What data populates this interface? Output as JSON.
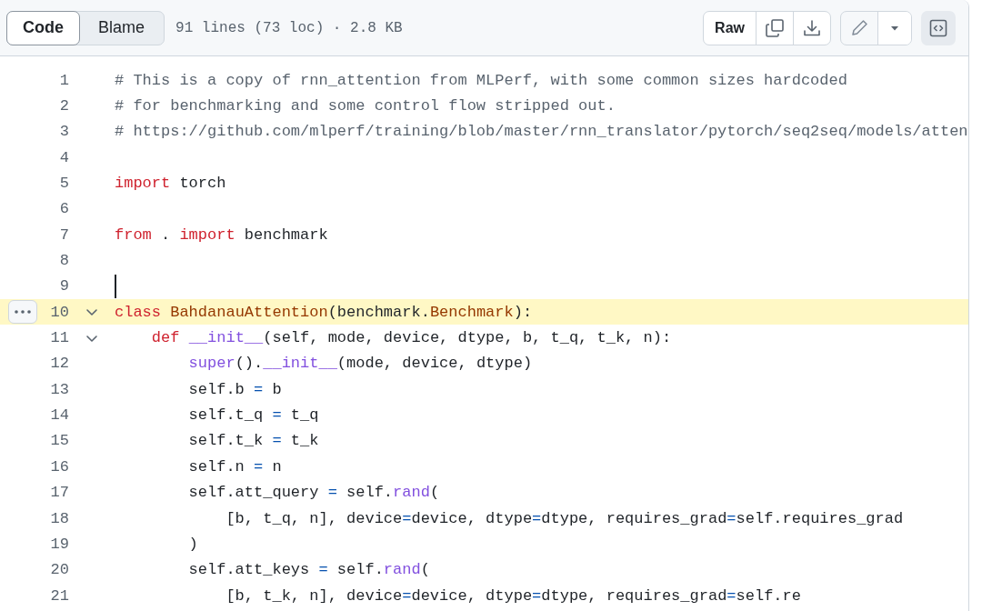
{
  "toolbar": {
    "view_tabs": [
      {
        "label": "Code",
        "selected": true
      },
      {
        "label": "Blame",
        "selected": false
      }
    ],
    "file_info": "91 lines (73 loc) · 2.8 KB",
    "raw_button": "Raw",
    "symbols_button": {
      "selected": true
    }
  },
  "code": {
    "lines": [
      {
        "number": "1",
        "selected": false,
        "cursor": false,
        "foldable": false,
        "tokens": [
          {
            "kind": "comment",
            "text": "# This is a copy of rnn_attention from MLPerf, with some common sizes hardcoded"
          }
        ]
      },
      {
        "number": "2",
        "selected": false,
        "cursor": false,
        "foldable": false,
        "tokens": [
          {
            "kind": "comment",
            "text": "# for benchmarking and some control flow stripped out."
          }
        ]
      },
      {
        "number": "3",
        "selected": false,
        "cursor": false,
        "foldable": false,
        "tokens": [
          {
            "kind": "comment",
            "text": "# https://github.com/mlperf/training/blob/master/rnn_translator/pytorch/seq2seq/models/atten"
          }
        ]
      },
      {
        "number": "4",
        "selected": false,
        "cursor": false,
        "foldable": false
      },
      {
        "number": "5",
        "selected": false,
        "cursor": false,
        "foldable": false,
        "tokens": [
          {
            "kind": "keyword",
            "text": "import"
          },
          {
            "kind": "plain",
            "text": " torch"
          }
        ]
      },
      {
        "number": "6",
        "selected": false,
        "cursor": false,
        "foldable": false
      },
      {
        "number": "7",
        "selected": false,
        "cursor": false,
        "foldable": false,
        "tokens": [
          {
            "kind": "keyword",
            "text": "from"
          },
          {
            "kind": "plain",
            "text": " . "
          },
          {
            "kind": "keyword",
            "text": "import"
          },
          {
            "kind": "plain",
            "text": " benchmark"
          }
        ]
      },
      {
        "number": "8",
        "selected": false,
        "cursor": false,
        "foldable": false
      },
      {
        "number": "9",
        "selected": false,
        "cursor": true,
        "foldable": false
      },
      {
        "number": "10",
        "selected": true,
        "cursor": false,
        "foldable": true,
        "tokens": [
          {
            "kind": "keyword",
            "text": "class "
          },
          {
            "kind": "name",
            "text": "BahdanauAttention"
          },
          {
            "kind": "plain",
            "text": "(benchmark."
          },
          {
            "kind": "name",
            "text": "Benchmark"
          },
          {
            "kind": "plain",
            "text": "):"
          }
        ]
      },
      {
        "number": "11",
        "selected": false,
        "cursor": false,
        "foldable": true,
        "tokens": [
          {
            "kind": "keyword",
            "text": "    def "
          },
          {
            "kind": "call",
            "text": "__init__"
          },
          {
            "kind": "plain",
            "text": "(self, mode, device, dtype, b, t_q, t_k, n):"
          }
        ]
      },
      {
        "number": "12",
        "selected": false,
        "cursor": false,
        "foldable": false,
        "tokens": [
          {
            "kind": "call",
            "text": "        super"
          },
          {
            "kind": "plain",
            "text": "()."
          },
          {
            "kind": "call",
            "text": "__init__"
          },
          {
            "kind": "plain",
            "text": "(mode, device, dtype)"
          }
        ]
      },
      {
        "number": "13",
        "selected": false,
        "cursor": false,
        "foldable": false,
        "tokens": [
          {
            "kind": "plain",
            "text": "        self.b "
          },
          {
            "kind": "operator",
            "text": "="
          },
          {
            "kind": "plain",
            "text": " b"
          }
        ]
      },
      {
        "number": "14",
        "selected": false,
        "cursor": false,
        "foldable": false,
        "tokens": [
          {
            "kind": "plain",
            "text": "        self.t_q "
          },
          {
            "kind": "operator",
            "text": "="
          },
          {
            "kind": "plain",
            "text": " t_q"
          }
        ]
      },
      {
        "number": "15",
        "selected": false,
        "cursor": false,
        "foldable": false,
        "tokens": [
          {
            "kind": "plain",
            "text": "        self.t_k "
          },
          {
            "kind": "operator",
            "text": "="
          },
          {
            "kind": "plain",
            "text": " t_k"
          }
        ]
      },
      {
        "number": "16",
        "selected": false,
        "cursor": false,
        "foldable": false,
        "tokens": [
          {
            "kind": "plain",
            "text": "        self.n "
          },
          {
            "kind": "operator",
            "text": "="
          },
          {
            "kind": "plain",
            "text": " n"
          }
        ]
      },
      {
        "number": "17",
        "selected": false,
        "cursor": false,
        "foldable": false,
        "tokens": [
          {
            "kind": "plain",
            "text": "        self.att_query "
          },
          {
            "kind": "operator",
            "text": "="
          },
          {
            "kind": "plain",
            "text": " self."
          },
          {
            "kind": "call",
            "text": "rand"
          },
          {
            "kind": "plain",
            "text": "("
          }
        ]
      },
      {
        "number": "18",
        "selected": false,
        "cursor": false,
        "foldable": false,
        "tokens": [
          {
            "kind": "plain",
            "text": "            [b, t_q, n], device"
          },
          {
            "kind": "operator",
            "text": "="
          },
          {
            "kind": "plain",
            "text": "device, dtype"
          },
          {
            "kind": "operator",
            "text": "="
          },
          {
            "kind": "plain",
            "text": "dtype, requires_grad"
          },
          {
            "kind": "operator",
            "text": "="
          },
          {
            "kind": "plain",
            "text": "self.requires_grad"
          }
        ]
      },
      {
        "number": "19",
        "selected": false,
        "cursor": false,
        "foldable": false,
        "tokens": [
          {
            "kind": "plain",
            "text": "        )"
          }
        ]
      },
      {
        "number": "20",
        "selected": false,
        "cursor": false,
        "foldable": false,
        "tokens": [
          {
            "kind": "plain",
            "text": "        self.att_keys "
          },
          {
            "kind": "operator",
            "text": "="
          },
          {
            "kind": "plain",
            "text": " self."
          },
          {
            "kind": "call",
            "text": "rand"
          },
          {
            "kind": "plain",
            "text": "("
          }
        ]
      },
      {
        "number": "21",
        "selected": false,
        "cursor": false,
        "foldable": false,
        "tokens": [
          {
            "kind": "plain",
            "text": "            [b, t_k, n], device"
          },
          {
            "kind": "operator",
            "text": "="
          },
          {
            "kind": "plain",
            "text": "device, dtype"
          },
          {
            "kind": "operator",
            "text": "="
          },
          {
            "kind": "plain",
            "text": "dtype, requires_grad"
          },
          {
            "kind": "operator",
            "text": "="
          },
          {
            "kind": "plain",
            "text": "self.re"
          }
        ]
      }
    ]
  }
}
